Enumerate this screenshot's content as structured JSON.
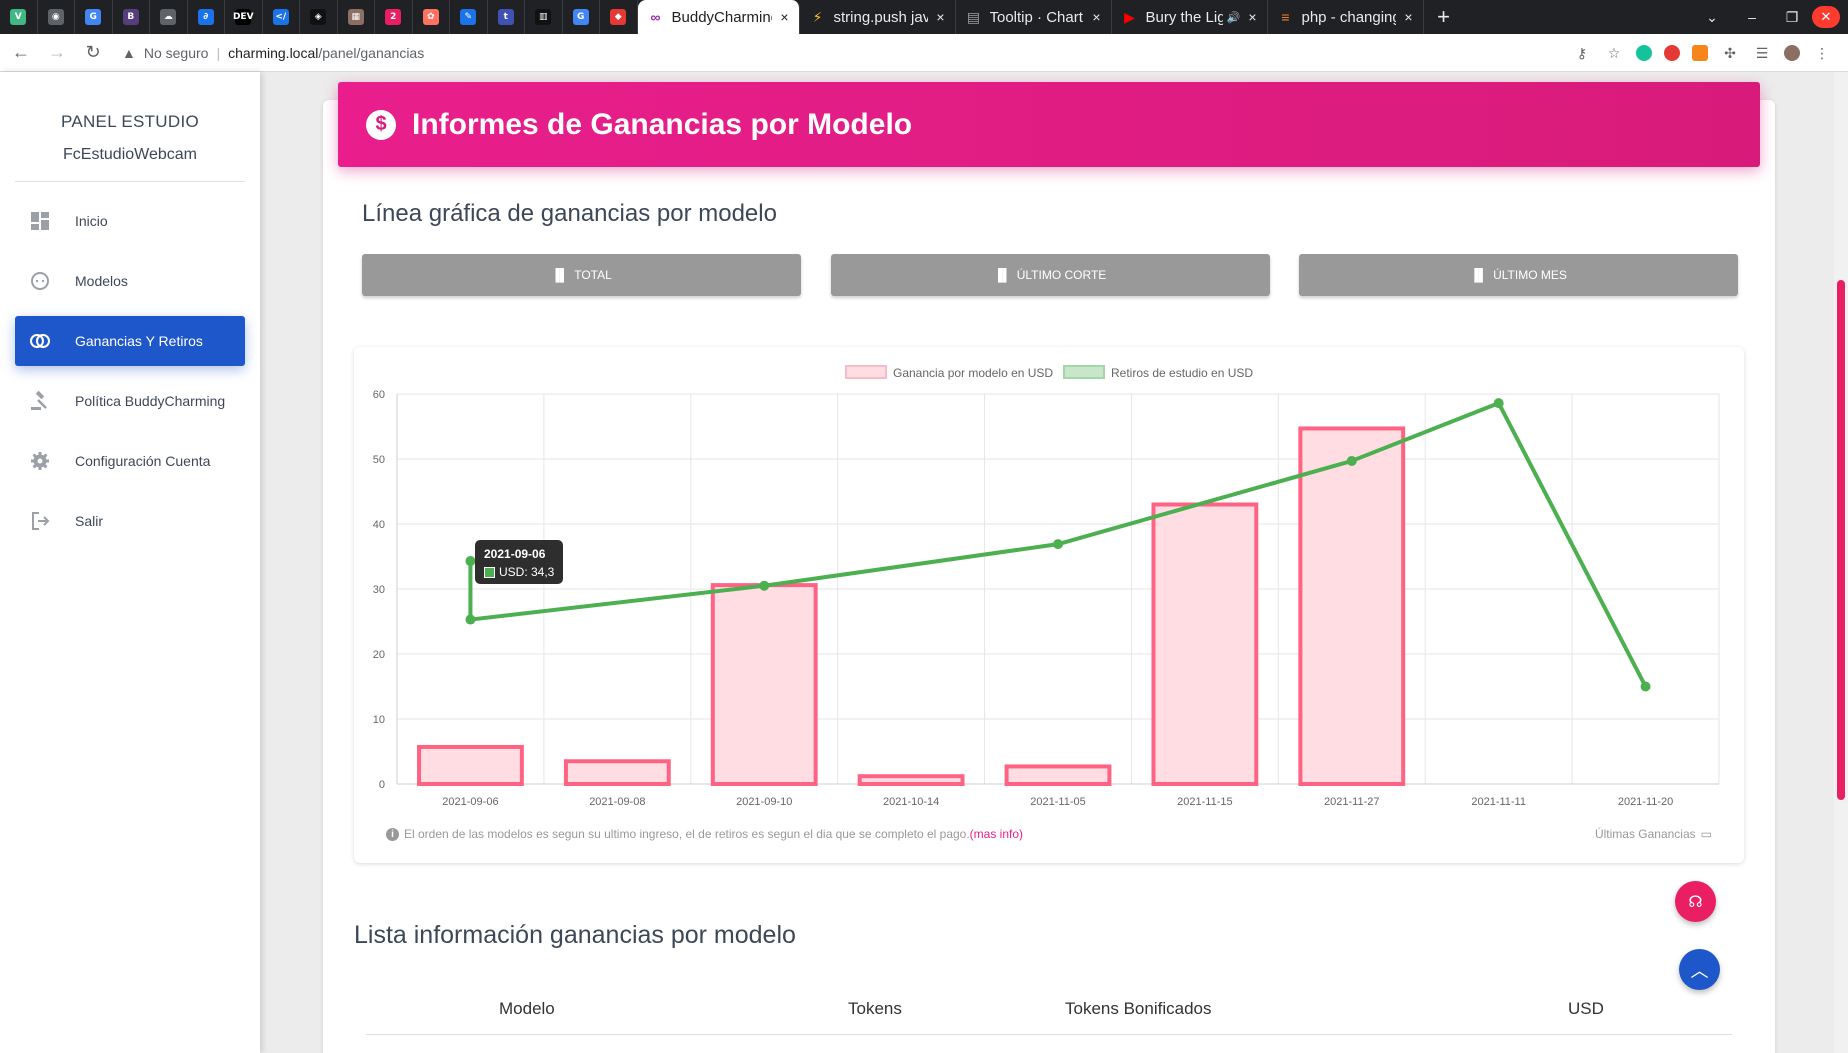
{
  "browser": {
    "mini_tabs": [
      {
        "icon": "vue-icon",
        "color": "#41b883",
        "glyph": "V"
      },
      {
        "icon": "compass-icon",
        "color": "#5f6368",
        "glyph": "◉"
      },
      {
        "icon": "google-icon",
        "color": "#4285f4",
        "glyph": "G"
      },
      {
        "icon": "bootstrap-icon",
        "color": "#563d7c",
        "glyph": "B"
      },
      {
        "icon": "cloud-icon",
        "color": "#5f6368",
        "glyph": "☁"
      },
      {
        "icon": "link-icon",
        "color": "#1a73e8",
        "glyph": "∂"
      },
      {
        "icon": "dev-icon",
        "color": "#000000",
        "glyph": "DEV"
      },
      {
        "icon": "code-icon",
        "color": "#1a73e8",
        "glyph": "</"
      },
      {
        "icon": "codepen-icon",
        "color": "#111111",
        "glyph": "◈"
      },
      {
        "icon": "grid-icon",
        "color": "#8d6e63",
        "glyph": "▦"
      },
      {
        "icon": "two-icon",
        "color": "#e91e63",
        "glyph": "2"
      },
      {
        "icon": "figma-icon",
        "color": "#ff7262",
        "glyph": "✿"
      },
      {
        "icon": "feather-icon",
        "color": "#1a73e8",
        "glyph": "✎"
      },
      {
        "icon": "t-icon",
        "color": "#3f51b5",
        "glyph": "t"
      },
      {
        "icon": "trello-icon",
        "color": "#111111",
        "glyph": "▥"
      },
      {
        "icon": "google-icon",
        "color": "#4285f4",
        "glyph": "G"
      },
      {
        "icon": "cube-icon",
        "color": "#e53935",
        "glyph": "◆"
      }
    ],
    "tabs": [
      {
        "label": "BuddyCharming",
        "icon": "buddy-icon",
        "color": "#9c27b0",
        "glyph": "∞",
        "active": true
      },
      {
        "label": "string.push javascr",
        "icon": "bolt-icon",
        "color": "#fbc02d",
        "glyph": "⚡",
        "active": false
      },
      {
        "label": "Tooltip · Chart.js d",
        "icon": "chartjs-icon",
        "color": "#9e9e9e",
        "glyph": "▤",
        "active": false
      },
      {
        "label": "Bury the Light",
        "icon": "youtube-icon",
        "color": "#ff0000",
        "glyph": "▶",
        "active": false,
        "audio": "🔊"
      },
      {
        "label": "php - changing arr",
        "icon": "stackoverflow-icon",
        "color": "#f48024",
        "glyph": "≡",
        "active": false
      }
    ],
    "tab_close": "×",
    "new_tab": "+",
    "url_warning": "No seguro",
    "url_host": "charming.local",
    "url_path": "/panel/ganancias"
  },
  "sidebar": {
    "brand_line1": "PANEL ESTUDIO",
    "brand_line2": "FcEstudioWebcam",
    "items": [
      {
        "label": "Inicio",
        "icon": "dashboard-icon",
        "active": false
      },
      {
        "label": "Modelos",
        "icon": "face-icon",
        "active": false
      },
      {
        "label": "Ganancias Y Retiros",
        "icon": "loop-icon",
        "active": true
      },
      {
        "label": "Política BuddyCharming",
        "icon": "gavel-icon",
        "active": false
      },
      {
        "label": "Configuración Cuenta",
        "icon": "gear-icon",
        "active": false
      },
      {
        "label": "Salir",
        "icon": "logout-icon",
        "active": false
      }
    ]
  },
  "header": {
    "title": "Informes de Ganancias por Modelo",
    "icon": "dollar-icon"
  },
  "section": {
    "title": "Línea gráfica de ganancias por modelo",
    "buttons": [
      "TOTAL",
      "ÚLTIMO CORTE",
      "ÚLTIMO MES"
    ]
  },
  "chart_data": {
    "type": "bar",
    "categories": [
      "2021-09-06",
      "2021-09-08",
      "2021-09-10",
      "2021-10-14",
      "2021-11-05",
      "2021-11-15",
      "2021-11-27",
      "2021-11-11",
      "2021-11-20"
    ],
    "series": [
      {
        "name": "Ganancia por modelo en USD",
        "type": "bar",
        "color": "#ff6384",
        "fill": "#ffdde3",
        "values": [
          5.7,
          3.5,
          30.6,
          1.2,
          2.7,
          43.0,
          54.7,
          null,
          null
        ]
      },
      {
        "name": "Retiros de estudio en USD",
        "type": "line",
        "color": "#4caf50",
        "fill": "#c8e6c9",
        "values": [
          25.3,
          null,
          30.5,
          null,
          36.9,
          null,
          49.7,
          58.6,
          15.0
        ],
        "extra_point": {
          "category": "2021-09-06",
          "value": 34.3
        }
      }
    ],
    "ylim": [
      0,
      60
    ],
    "yticks": [
      0,
      10,
      20,
      30,
      40,
      50,
      60
    ],
    "legend": "top-center",
    "grid": true,
    "tooltip": {
      "title": "2021-09-06",
      "line": "USD: 34,3"
    }
  },
  "chart_footer": {
    "note": "El orden de las modelos es segun su ultimo ingreso, el de retiros es segun el dia que se completo el pago.",
    "more": "(mas info)",
    "right": "Últimas Ganancias"
  },
  "list": {
    "title": "Lista información ganancias por modelo",
    "columns": [
      "Modelo",
      "Tokens",
      "Tokens Bonificados",
      "USD"
    ]
  }
}
